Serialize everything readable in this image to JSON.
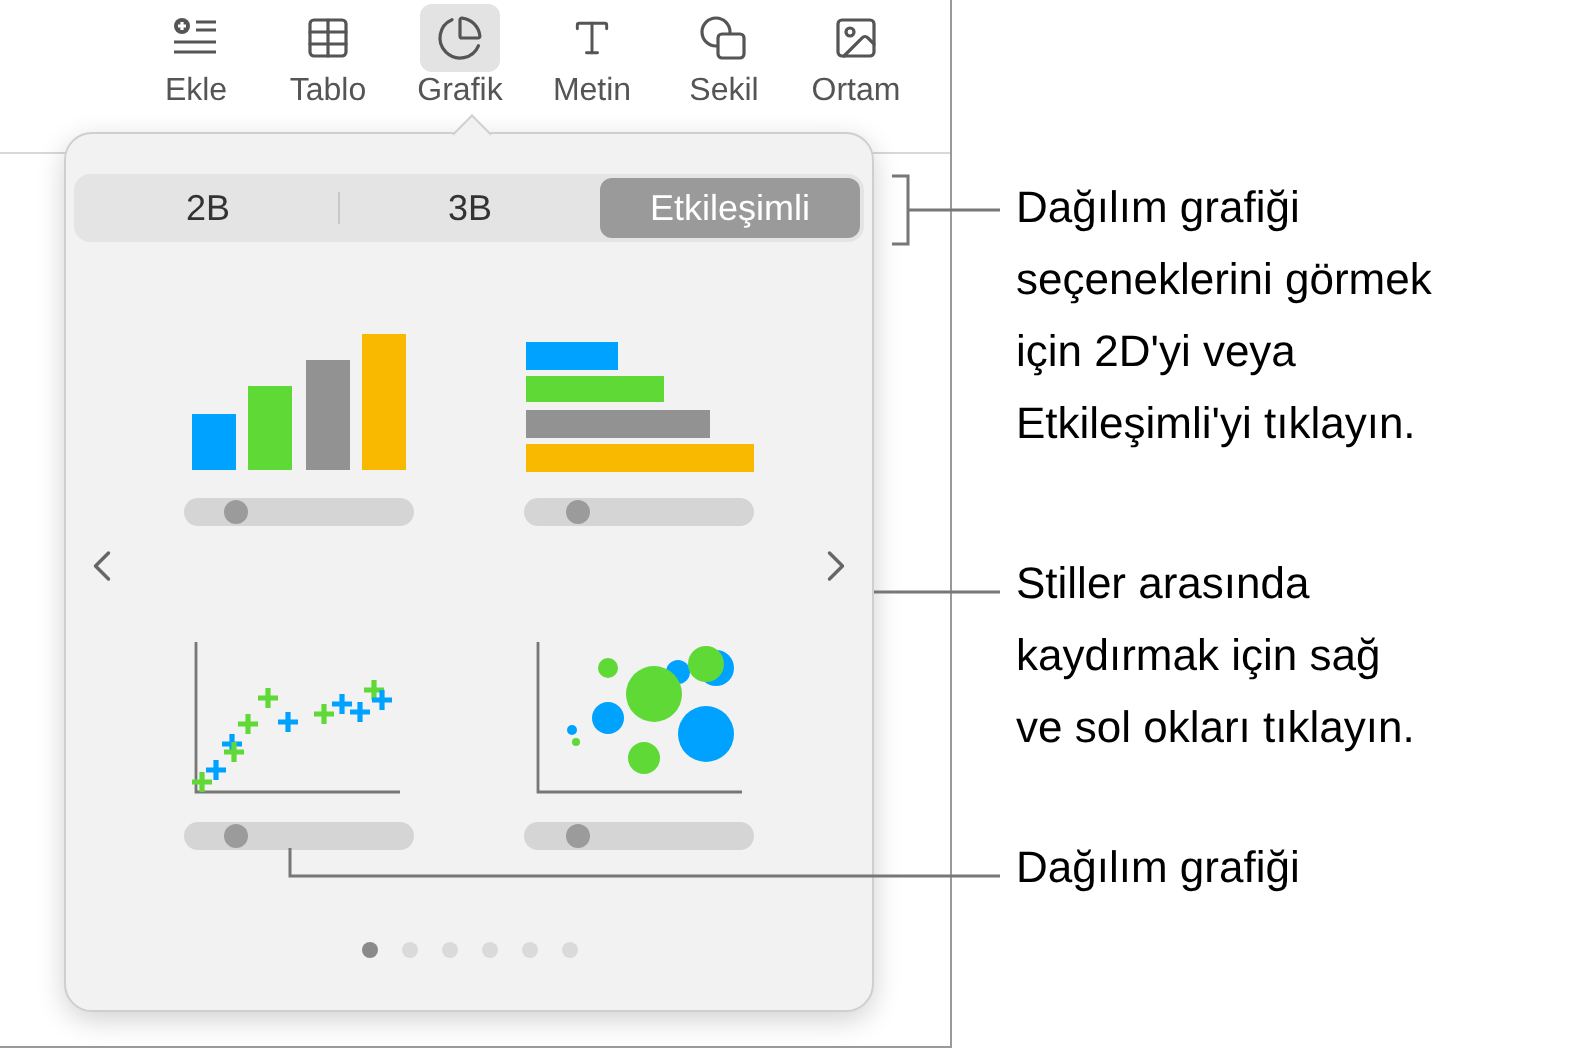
{
  "toolbar": {
    "items": [
      {
        "kind": "insert",
        "label": "Ekle",
        "selected": false
      },
      {
        "kind": "table",
        "label": "Tablo",
        "selected": false
      },
      {
        "kind": "chart",
        "label": "Grafik",
        "selected": true
      },
      {
        "kind": "text",
        "label": "Metin",
        "selected": false
      },
      {
        "kind": "shape",
        "label": "Sekil",
        "selected": false
      },
      {
        "kind": "media",
        "label": "Ortam",
        "selected": false
      }
    ]
  },
  "popover": {
    "segments": [
      {
        "label": "2B",
        "selected": false
      },
      {
        "label": "3B",
        "selected": false
      },
      {
        "label": "Etkileşimli",
        "selected": true
      }
    ],
    "chart_styles": [
      {
        "kind": "column",
        "level": 0.2
      },
      {
        "kind": "bar",
        "level": 0.2
      },
      {
        "kind": "scatter",
        "level": 0.2
      },
      {
        "kind": "bubble",
        "level": 0.2
      }
    ],
    "pages": [
      {
        "selected": true
      },
      {
        "selected": false
      },
      {
        "selected": false
      },
      {
        "selected": false
      },
      {
        "selected": false
      },
      {
        "selected": false
      }
    ]
  },
  "callouts": [
    {
      "text": "Dağılım grafiği\nseçeneklerini görmek\niçin 2D'yi veya\nEtkileşimli'yi tıklayın."
    },
    {
      "text": "Stiller arasında\nkaydırmak için sağ\nve sol okları tıklayın."
    },
    {
      "text": "Dağılım grafiği"
    }
  ]
}
